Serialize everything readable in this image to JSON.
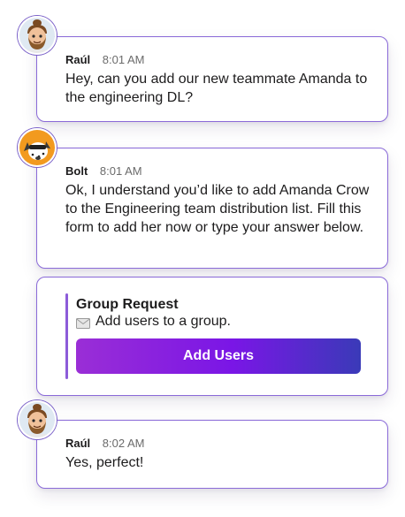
{
  "messages": [
    {
      "sender": "Raúl",
      "time": "8:01 AM",
      "text": "Hey, can you add our new teammate Amanda to the engineering DL?"
    },
    {
      "sender": "Bolt",
      "time": "8:01 AM",
      "text": "Ok, I understand you’d like to add Amanda Crow to the Engineering team distribution list. Fill this form to add her now or type your answer below."
    },
    {
      "sender": "Raúl",
      "time": "8:02 AM",
      "text": "Yes, perfect!"
    }
  ],
  "form": {
    "title": "Group Request",
    "subtitle": "Add users to a group.",
    "subtitle_icon": "envelope-icon",
    "button_label": "Add Users"
  },
  "avatars": {
    "user_icon": "bearded-man-avatar",
    "bot_icon": "dog-mascot-avatar"
  },
  "colors": {
    "card_border": "#8a6ad8",
    "button_gradient_start": "#9a2ed6",
    "button_gradient_end": "#3a3ab8",
    "form_accent_bar": "#8c5cd9"
  }
}
